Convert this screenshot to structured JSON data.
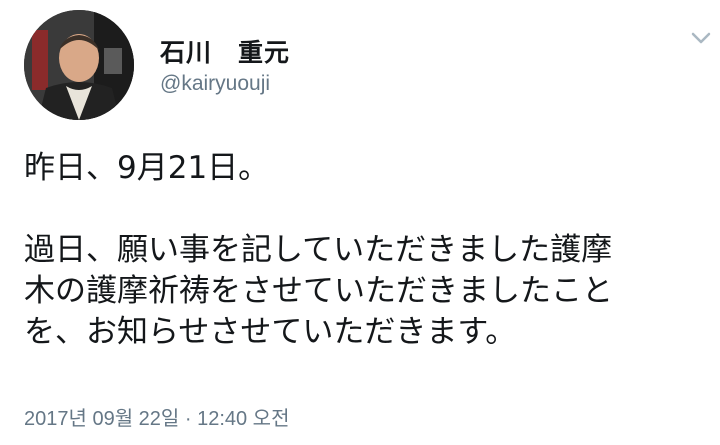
{
  "user": {
    "display_name": "石川　重元",
    "handle": "@kairyuouji"
  },
  "tweet": {
    "line1": "昨日、9月21日。",
    "line2": "過日、願い事を記していただきました護摩",
    "line3": "木の護摩祈祷をさせていただきましたこと",
    "line4": "を、お知らせさせていただきます。",
    "timestamp": "2017년 09월 22일 · 12:40 오전"
  },
  "icons": {
    "menu": "chevron-down-icon"
  }
}
